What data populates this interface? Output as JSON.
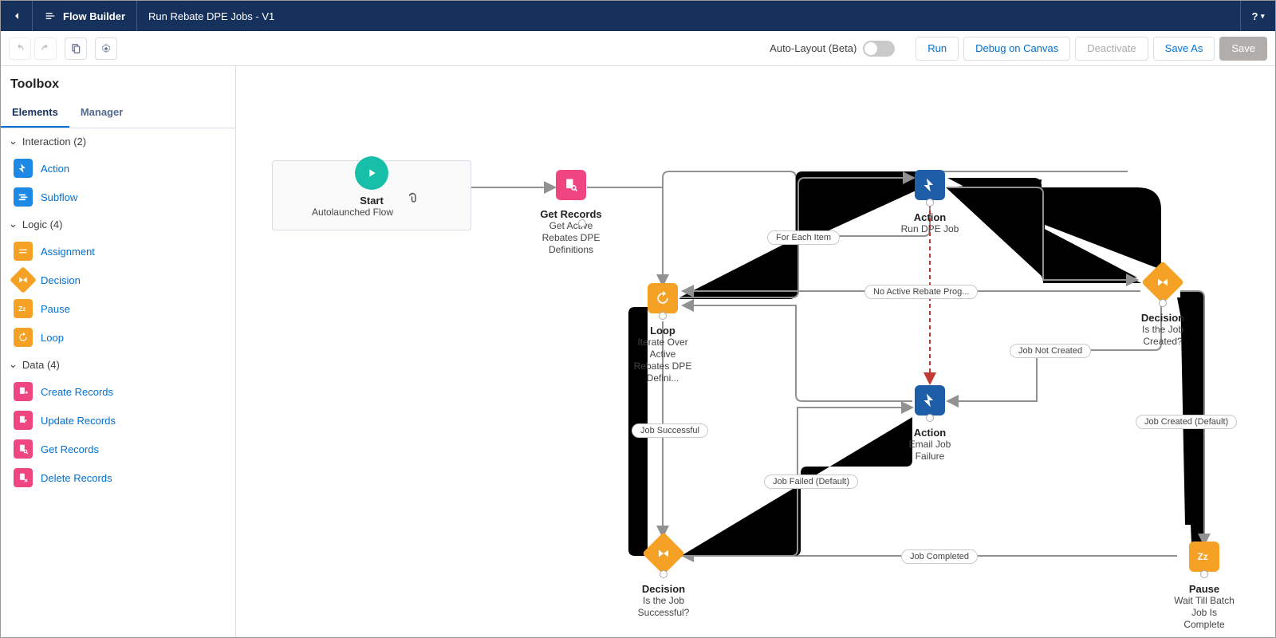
{
  "header": {
    "app_name": "Flow Builder",
    "page_title": "Run Rebate DPE Jobs - V1",
    "help": "?"
  },
  "toolbar": {
    "auto_layout_label": "Auto-Layout (Beta)",
    "run": "Run",
    "debug": "Debug on Canvas",
    "deactivate": "Deactivate",
    "saveas": "Save As",
    "save": "Save"
  },
  "sidebar": {
    "title": "Toolbox",
    "tabs": {
      "elements": "Elements",
      "manager": "Manager"
    },
    "groups": {
      "interaction": {
        "label": "Interaction (2)",
        "items": [
          "Action",
          "Subflow"
        ]
      },
      "logic": {
        "label": "Logic (4)",
        "items": [
          "Assignment",
          "Decision",
          "Pause",
          "Loop"
        ]
      },
      "data": {
        "label": "Data (4)",
        "items": [
          "Create Records",
          "Update Records",
          "Get Records",
          "Delete Records"
        ]
      }
    }
  },
  "nodes": {
    "start": {
      "label": "Start",
      "sub": "Autolaunched Flow"
    },
    "get_records": {
      "type": "Get Records",
      "label": "Get Active Rebates DPE Definitions"
    },
    "loop": {
      "type": "Loop",
      "label": "Iterate Over Active Rebates DPE Defini..."
    },
    "action_run": {
      "type": "Action",
      "label": "Run DPE Job"
    },
    "action_email": {
      "type": "Action",
      "label": "Email Job Failure"
    },
    "decision_created": {
      "type": "Decision",
      "label": "Is the Job Created?"
    },
    "decision_success": {
      "type": "Decision",
      "label": "Is the Job Successful?"
    },
    "pause": {
      "type": "Pause",
      "label": "Wait Till Batch Job Is Complete"
    }
  },
  "edges": {
    "for_each": "For Each Item",
    "no_active": "No Active Rebate Prog...",
    "job_not_created": "Job Not Created",
    "job_created": "Job Created (Default)",
    "job_successful": "Job Successful",
    "job_failed": "Job Failed (Default)",
    "job_completed": "Job Completed"
  }
}
